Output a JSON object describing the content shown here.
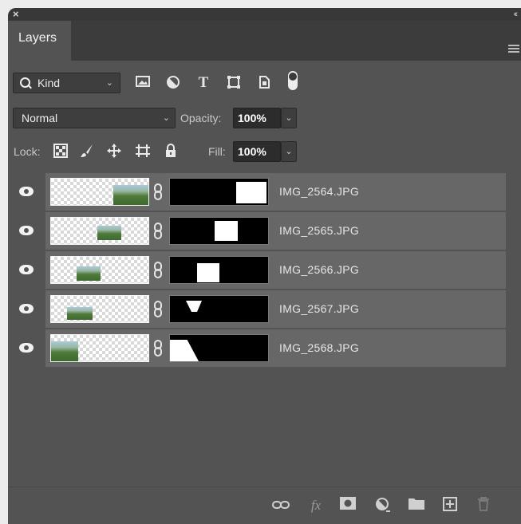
{
  "titlebar": {
    "close_glyph": "×",
    "collapse_glyph": "‹‹"
  },
  "tab": {
    "label": "Layers"
  },
  "filter": {
    "kind_label": "Kind",
    "icons": [
      "image-filter-icon",
      "adjustment-filter-icon",
      "type-filter-icon",
      "shape-filter-icon",
      "smart-object-filter-icon",
      "filter-toggle-icon"
    ]
  },
  "blend": {
    "mode": "Normal",
    "opacity_label": "Opacity:",
    "opacity_value": "100%"
  },
  "lock": {
    "label": "Lock:",
    "icons": [
      "lock-transparent-pixels-icon",
      "lock-image-pixels-icon",
      "lock-position-icon",
      "lock-artboard-icon",
      "lock-all-icon"
    ],
    "fill_label": "Fill:",
    "fill_value": "100%"
  },
  "layers": [
    {
      "name": "IMG_2564.JPG"
    },
    {
      "name": "IMG_2565.JPG"
    },
    {
      "name": "IMG_2566.JPG"
    },
    {
      "name": "IMG_2567.JPG"
    },
    {
      "name": "IMG_2568.JPG"
    }
  ],
  "bottom_icons": [
    "link-layers-icon",
    "fx-icon",
    "add-mask-icon",
    "adjustment-layer-icon",
    "new-group-icon",
    "new-layer-icon",
    "delete-layer-icon"
  ]
}
